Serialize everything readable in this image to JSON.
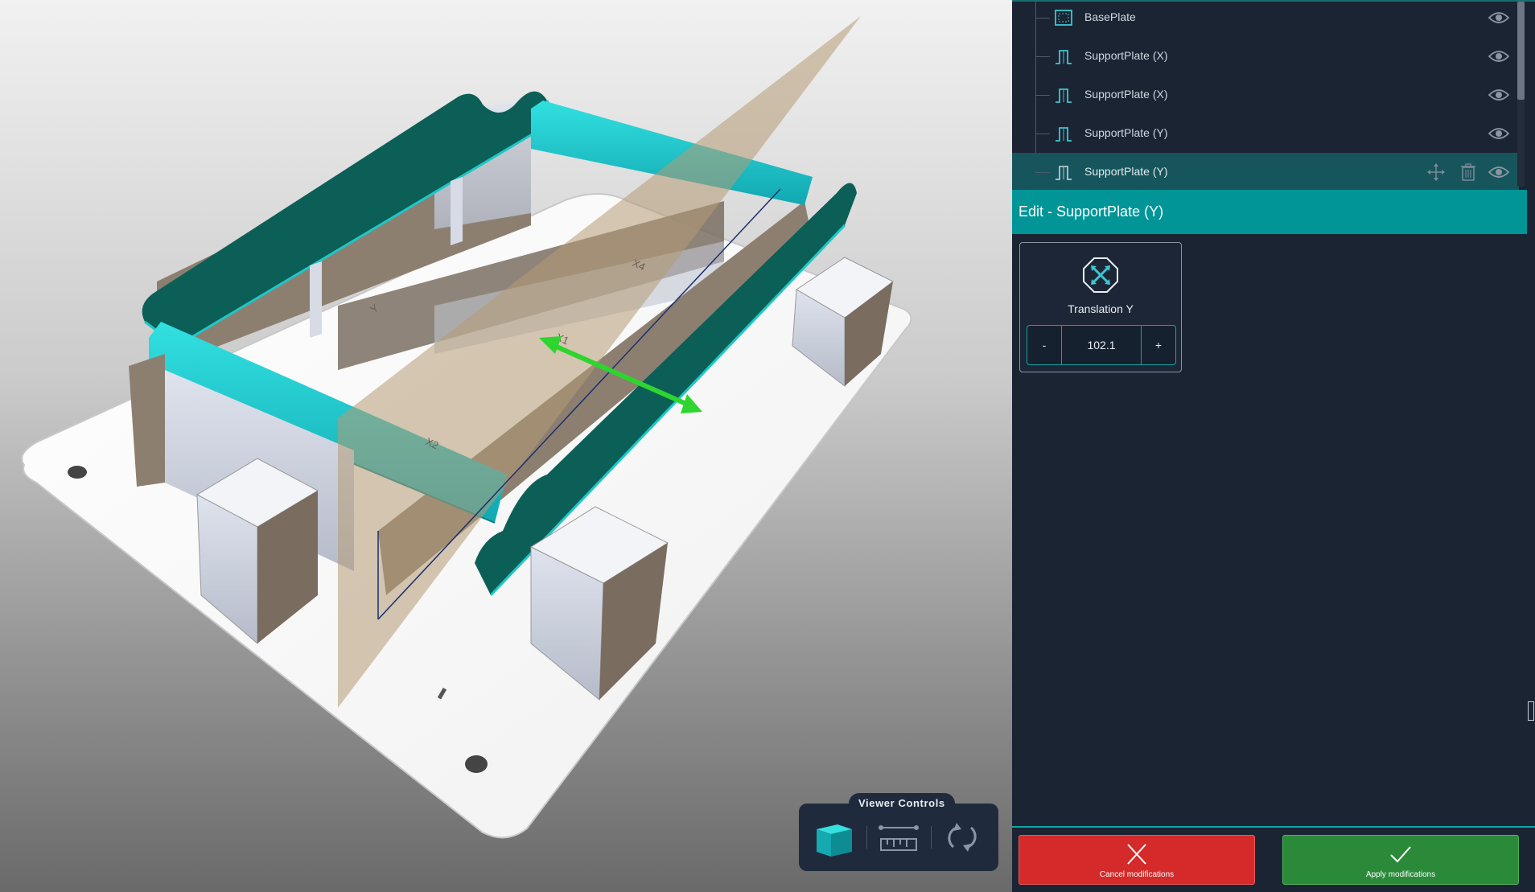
{
  "tree": {
    "items": [
      {
        "label": "BasePlate",
        "icon": "baseplate-icon"
      },
      {
        "label": "SupportPlate (X)",
        "icon": "support-plate-icon"
      },
      {
        "label": "SupportPlate (X)",
        "icon": "support-plate-icon"
      },
      {
        "label": "SupportPlate (Y)",
        "icon": "support-plate-icon"
      },
      {
        "label": "SupportPlate (Y)",
        "icon": "support-plate-icon",
        "selected": true
      }
    ]
  },
  "edit": {
    "title": "Edit - SupportPlate (Y)",
    "parameter": {
      "label": "Translation Y",
      "value": "102.1",
      "minus_label": "-",
      "plus_label": "+",
      "icon": "translation-icon"
    }
  },
  "viewer": {
    "controls_label": "Viewer Controls",
    "buttons": [
      "cube-view-icon",
      "measure-icon",
      "rotate-icon"
    ]
  },
  "actions": {
    "cancel_label": "Cancel modifications",
    "apply_label": "Apply modifications"
  },
  "scene_labels": {
    "x1": "X1",
    "x2": "X2",
    "x4": "X4",
    "y": "Y"
  },
  "colors": {
    "accent": "#019597",
    "panel_bg": "#1b2433",
    "selected_row": "#17555c",
    "cancel": "#d42a2a",
    "apply": "#2a8a3a",
    "teal_model": "#1fc7c7",
    "dark_green_model": "#0c5f57",
    "arrow": "#2ed52e"
  }
}
